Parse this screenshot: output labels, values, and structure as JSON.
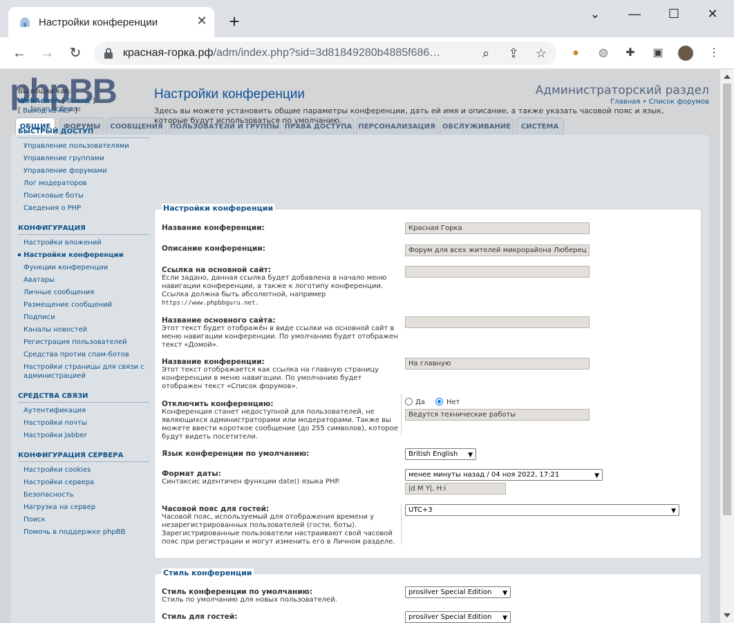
{
  "browser": {
    "tab_title": "Настройки конференции",
    "url_host": "красная-горка.рф",
    "url_path": "/adm/index.php?sid=3d81849280b4885f686…",
    "icons": [
      "back-icon",
      "forward-icon",
      "reload-icon",
      "lock-icon",
      "zoom-icon",
      "share-icon",
      "star-icon",
      "cookie-icon",
      "globe-icon",
      "puzzle-icon",
      "sidepanel-icon",
      "avatar",
      "menu-icon"
    ]
  },
  "header": {
    "admin_title": "Администраторский раздел",
    "link_home": "Главная",
    "link_sep": " • ",
    "link_forums": "Список форумов"
  },
  "tabs": [
    "ОБЩИЕ",
    "ФОРУМЫ",
    "СООБЩЕНИЯ",
    "ПОЛЬЗОВАТЕЛИ И ГРУППЫ",
    "ПРАВА ДОСТУПА",
    "ПЕРСОНАЛИЗАЦИЯ",
    "ОБСЛУЖИВАНИЕ",
    "СИСТЕМА"
  ],
  "sidebar": {
    "logged_as": "Вы вошли как:",
    "username": "WebAdmin",
    "logout": "Выход",
    "acp_logout": "Выход из ACP",
    "quick_access": {
      "title": "БЫСТРЫЙ ДОСТУП",
      "items": [
        "Управление пользователями",
        "Управление группами",
        "Управление форумами",
        "Лог модераторов",
        "Поисковые боты",
        "Сведения о PHP"
      ]
    },
    "configuration": {
      "title": "КОНФИГУРАЦИЯ",
      "items": [
        "Настройки вложений",
        "Настройки конференции",
        "Функции конференции",
        "Аватары",
        "Личные сообщения",
        "Размещение сообщений",
        "Подписи",
        "Каналы новостей",
        "Регистрация пользователей",
        "Средства против спам-ботов",
        "Настройки страницы для связи с администрацией"
      ]
    },
    "communication": {
      "title": "СРЕДСТВА СВЯЗИ",
      "items": [
        "Аутентификация",
        "Настройки почты",
        "Настройки Jabber"
      ]
    },
    "server": {
      "title": "КОНФИГУРАЦИЯ СЕРВЕРА",
      "items": [
        "Настройки cookies",
        "Настройки сервера",
        "Безопасность",
        "Нагрузка на сервер",
        "Поиск",
        "Помочь в поддержке phpBB"
      ]
    }
  },
  "main": {
    "title": "Настройки конференции",
    "description": "Здесь вы можете установить общие параметры конференции, дать ей имя и описание, а также указать часовой пояс и язык, которые будут использоваться по умолчанию.",
    "fieldset1_legend": "Настройки конференции",
    "fields": {
      "sitename_label": "Название конференции:",
      "sitename_value": "Красная Горка",
      "sitedesc_label": "Описание конференции:",
      "sitedesc_value": "Форум для всех жителей микрорайона Люберец",
      "homeurl_label": "Ссылка на основной сайт:",
      "homeurl_help": "Если задано, данная ссылка будет добавлена в начало меню навигации конференции, а также к логотипу конференции. Ссылка должна быть абсолютной, например",
      "homeurl_example": "https://www.phpbbguru.net.",
      "homename_label": "Название основного сайта:",
      "homename_help": "Этот текст будет отображён в виде ссылки на основной сайт в меню навигации конференции. По умолчанию будет отображен текст «Домой».",
      "indextext_label": "Название конференции:",
      "indextext_help": "Этот текст отображается как ссылка на главную страницу конференции в меню навигации. По умолчанию будет отображен текст «Список форумов».",
      "indextext_value": "На главную",
      "disable_label": "Отключить конференцию:",
      "disable_help": "Конференция станет недоступной для пользователей, не являющихся администраторами или модераторами. Также вы можете ввести короткое сообщение (до 255 символов), которое будут видеть посетители.",
      "disable_yes": "Да",
      "disable_no": "Нет",
      "disable_msg": "Ведутся технические работы",
      "lang_label": "Язык конференции по умолчанию:",
      "lang_value": "British English",
      "date_label": "Формат даты:",
      "date_help": "Синтаксис идентичен функции date() языка PHP.",
      "date_select": "менее минуты назад / 04 ноя 2022, 17:21",
      "date_custom": "|d M Y|, H:i",
      "tz_label": "Часовой пояс для гостей:",
      "tz_help": "Часовой пояс, используемый для отображения времени у незарегистрированных пользователей (гости, боты). Зарегистрированные пользователи настраивают свой часовой пояс при регистрации и могут изменить его в Личном разделе.",
      "tz_value": "UTC+3"
    },
    "fieldset2_legend": "Стиль конференции",
    "style_label": "Стиль конференции по умолчанию:",
    "style_help": "Стиль по умолчанию для новых пользователей.",
    "style_value": "prosilver Special Edition",
    "guest_style_label": "Стиль для гостей:",
    "guest_style_value": "prosilver Special Edition"
  }
}
